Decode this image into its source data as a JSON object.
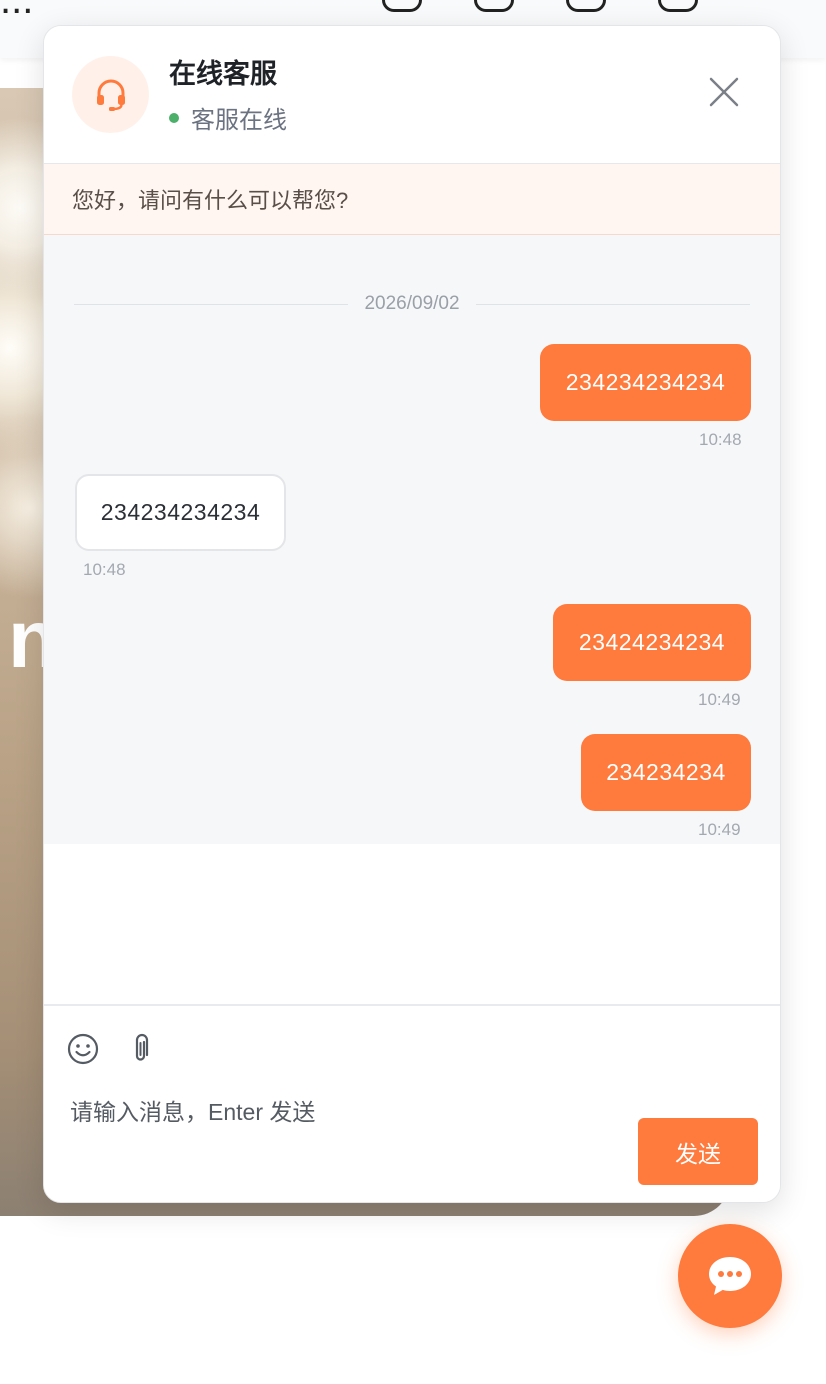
{
  "chat": {
    "title": "在线客服",
    "status": "客服在线",
    "notice": "您好，请问有什么可以帮您?",
    "date": "2026/09/02",
    "messages": [
      {
        "direction": "out",
        "text": "234234234234",
        "time": "10:48"
      },
      {
        "direction": "in",
        "text": "234234234234",
        "time": "10:48"
      },
      {
        "direction": "out",
        "text": "23424234234",
        "time": "10:49"
      },
      {
        "direction": "out",
        "text": "234234234",
        "time": "10:49"
      }
    ],
    "input_placeholder": "请输入消息，Enter 发送",
    "send_label": "发送",
    "icons": {
      "avatar": "headset-icon",
      "close": "close-icon",
      "emoji": "smiley-icon",
      "attach": "paperclip-icon",
      "fab": "chat-bubble-icon"
    }
  },
  "background": {
    "hero_text": "n",
    "top_text": "..."
  },
  "colors": {
    "accent": "#ff7a3d",
    "online": "#4caf6a",
    "notice_bg": "#fff6f2",
    "messages_bg": "#f6f7f9"
  }
}
